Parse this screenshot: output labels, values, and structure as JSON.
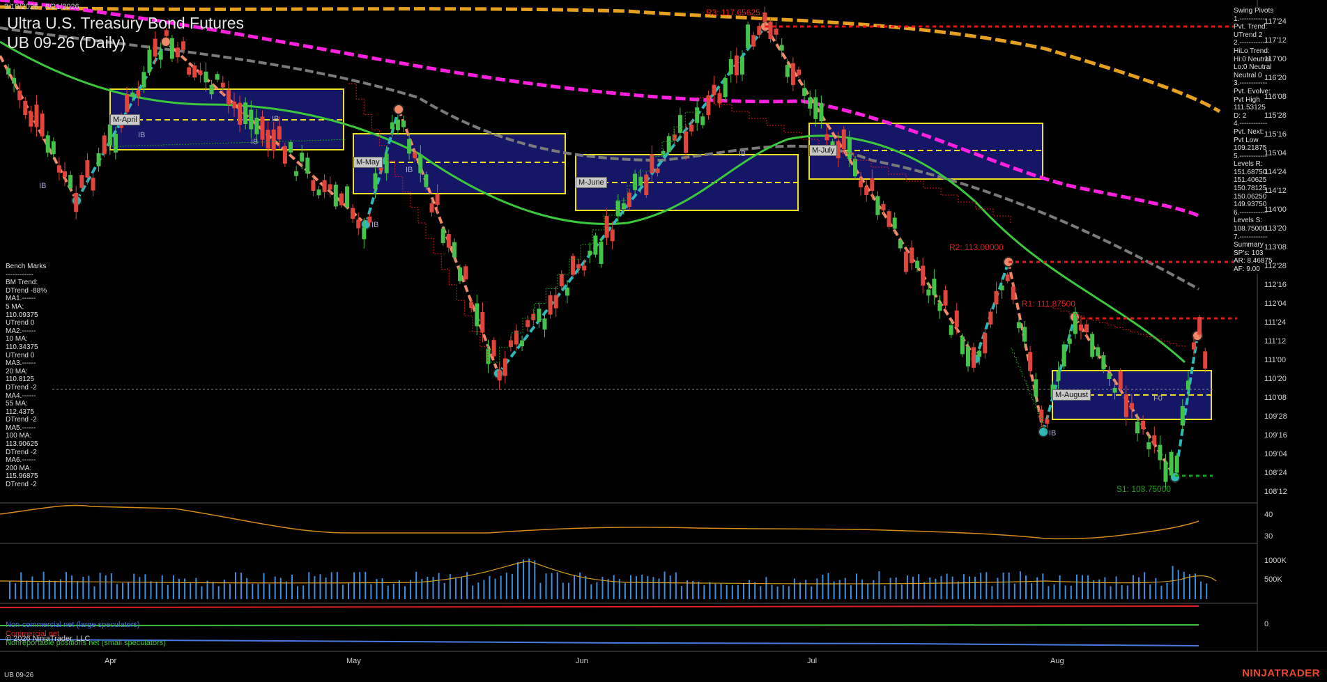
{
  "header": {
    "date_range": "3/19/2026 - 8/21/2026",
    "title": "Ultra U.S. Treasury Bond Futures",
    "subtitle": "UB 09-26 (Daily)"
  },
  "swing_pivots": [
    "Swing Pivots",
    "1.------------",
    "Pvt. Trend:",
    "UTrend 2",
    "2.------------",
    "HiLo Trend:",
    "Hi:0 Neutral",
    "Lo:0 Neutral",
    "Neutral 0",
    "3.------------",
    "Pvt. Evolve:",
    "Pvt High",
    "111.53125",
    "D: 2",
    "4.------------",
    "Pvt. Next:",
    "Pvt Low",
    "109.21875",
    "5.------------",
    "Levels R:",
    "151.68750",
    "151.40625",
    "150.78125",
    "150.06250",
    "149.93750",
    "6.------------",
    "Levels S:",
    "108.75000",
    "7.------------",
    "Summary",
    "SP's: 103",
    "AR: 8.46875",
    "AF: 9.00"
  ],
  "bench_marks": [
    "Bench Marks",
    "------------",
    "BM Trend:",
    "DTrend -88%",
    "MA1.------",
    "5 MA:",
    "110.09375",
    "UTrend 0",
    "MA2.------",
    "10 MA:",
    "110.34375",
    "UTrend 0",
    "MA3.------",
    "20 MA:",
    "110.8125",
    "DTrend -2",
    "MA4.------",
    "55 MA:",
    "112.4375",
    "DTrend -2",
    "MA5.------",
    "100 MA:",
    "113.90625",
    "DTrend -2",
    "MA6.------",
    "200 MA:",
    "115.96875",
    "DTrend -2"
  ],
  "price_axis": [
    "117'24",
    "117'12",
    "117'00",
    "116'20",
    "116'08",
    "115'28",
    "115'16",
    "115'04",
    "114'24",
    "114'12",
    "114'00",
    "113'20",
    "113'08",
    "112'28",
    "112'16",
    "112'04",
    "111'24",
    "111'12",
    "111'00",
    "110'20",
    "110'08",
    "109'28",
    "109'16",
    "109'04",
    "108'24",
    "108'12"
  ],
  "indicator_axis": [
    "40",
    "30"
  ],
  "volume_axis": [
    "1000K",
    "500K"
  ],
  "cot_axis": [
    "0"
  ],
  "time_axis": [
    "Apr",
    "May",
    "Jun",
    "Jul",
    "Aug"
  ],
  "levels": {
    "r3": "R3: 117.65625",
    "r2": "R2: 113.00000",
    "r1": "R1: 111.87500",
    "s1": "S1: 108.75000"
  },
  "monthly_boxes": [
    "M-April",
    "M-May",
    "M-June",
    "M-July",
    "M-August"
  ],
  "ib_labels": [
    "IB",
    "IB",
    "IB",
    "IB",
    "IB",
    "IB",
    "IB",
    "IB"
  ],
  "f0_label": "F0",
  "legend": {
    "noncommercial": "Non-commercial net (large speculators)",
    "commercial": "Commercial net",
    "nonreportable": "Nonreportable positions net (small speculators)"
  },
  "copyright": "© 2026 NinjaTrader, LLC",
  "footer_symbol": "UB 09-26",
  "brand": "NINJATRADER",
  "colors": {
    "background": "#000000",
    "candle_up": "#44c24a",
    "candle_down": "#e0443a",
    "ma_fast": "#3cc83c",
    "ma_gray": "#7a7a7a",
    "ma_magenta": "#ff20e0",
    "ma_orange": "#e6a020",
    "swing_up": "#2fb8b8",
    "swing_down": "#f08a6a",
    "resistance": "#e01818",
    "support": "#18a018",
    "box_fill": "#1a1a78",
    "box_border": "#f0e020",
    "volume": "#3c8ee0",
    "noncommercial": "#4a7ae0",
    "commercial": "#e02020",
    "nonreportable": "#40c040"
  }
}
